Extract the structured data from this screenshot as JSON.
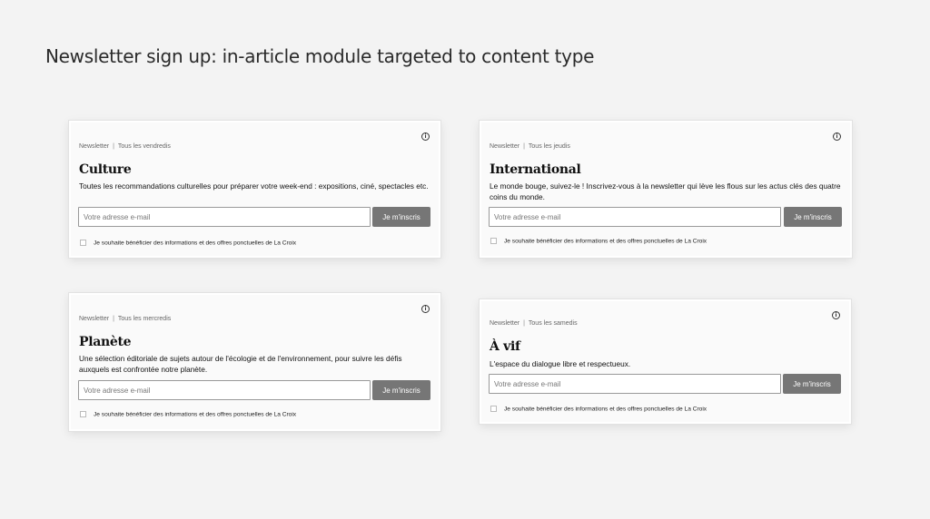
{
  "page": {
    "title": "Newsletter sign up: in-article module targeted to content type"
  },
  "cards": [
    {
      "category": "Newsletter",
      "frequency": "Tous les vendredis",
      "title": "Culture",
      "description": "Toutes les recommandations culturelles pour préparer votre week-end : expositions, ciné, spectacles etc.",
      "email_placeholder": "Votre adresse e-mail",
      "button_label": "Je m'inscris",
      "consent_label": "Je souhaite bénéficier des informations et des offres ponctuelles de La Croix"
    },
    {
      "category": "Newsletter",
      "frequency": "Tous les jeudis",
      "title": "International",
      "description": "Le monde bouge, suivez-le ! Inscrivez-vous à la newsletter qui lève les flous sur les actus clés des quatre coins du monde.",
      "email_placeholder": "Votre adresse e-mail",
      "button_label": "Je m'inscris",
      "consent_label": "Je souhaite bénéficier des informations et des offres ponctuelles de La Croix"
    },
    {
      "category": "Newsletter",
      "frequency": "Tous les mercredis",
      "title": "Planète",
      "description": "Une sélection éditoriale de sujets autour de l'écologie et de l'environnement, pour suivre les défis auxquels est confrontée notre planète.",
      "email_placeholder": "Votre adresse e-mail",
      "button_label": "Je m'inscris",
      "consent_label": "Je souhaite bénéficier des informations et des offres ponctuelles de La Croix"
    },
    {
      "category": "Newsletter",
      "frequency": "Tous les samedis",
      "title": "À vif",
      "description": "L'espace du dialogue libre et respectueux.",
      "email_placeholder": "Votre adresse e-mail",
      "button_label": "Je m'inscris",
      "consent_label": "Je souhaite bénéficier des informations et des offres ponctuelles de La Croix"
    }
  ],
  "icons": {
    "info": "info-circle-icon"
  },
  "colors": {
    "background": "#f3f3f3",
    "card_background": "#fafafa",
    "button": "#767676",
    "text": "#111111"
  }
}
